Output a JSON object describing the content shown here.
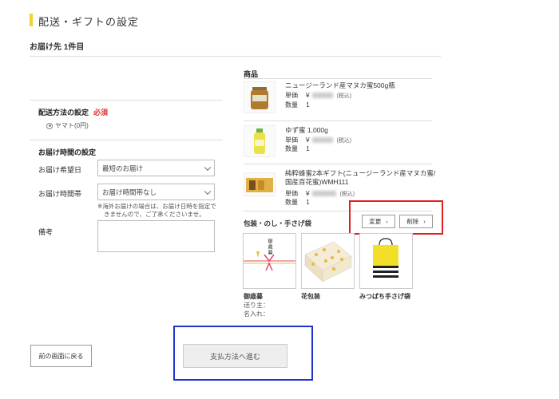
{
  "page": {
    "title": "配送・ギフトの設定"
  },
  "recipient": {
    "title": "お届け先 1件目"
  },
  "shipping_method": {
    "title": "配送方法の設定",
    "required": "必須",
    "option": "ヤマト(0円)"
  },
  "delivery_time": {
    "title": "お届け時間の設定",
    "date_label": "お届け希望日",
    "date_value": "最短のお届け",
    "time_label": "お届け時間帯",
    "time_value": "お届け時間帯なし",
    "note_line1": "※海外お届けの場合は、お届け日時を指定で",
    "note_line2": "きませんので、ご了承くださいませ。",
    "remarks_label": "備考"
  },
  "products": {
    "header": "商品",
    "price_label": "単価",
    "yen": "￥",
    "tax": "(税込)",
    "qty_label": "数量",
    "items": [
      {
        "name": "ニュージーランド産マヌカ蜜500g瓶",
        "qty": "1"
      },
      {
        "name": "ゆず蜜 1,000g",
        "qty": "1"
      },
      {
        "name_line1": "純粋蜂蜜2本ギフト(ニュージーランド産マヌカ蜜/",
        "name_line2": "国産百花蜜)WMH111",
        "qty": "1"
      }
    ]
  },
  "wrapping": {
    "title": "包装・のし・手さげ袋",
    "change_label": "変更",
    "delete_label": "削除",
    "chevron": "›",
    "options": [
      {
        "label": "御歳暮",
        "noshi_text": "御歳暮"
      },
      {
        "label": "花包装"
      },
      {
        "label": "みつばち手さげ袋"
      }
    ],
    "sender_label": "送り主：",
    "name_label": "名入れ："
  },
  "footer": {
    "back_label": "前の画面に戻る",
    "next_label": "支払方法へ進む"
  },
  "colors": {
    "accent_bar": "#f2d230",
    "required": "#d9322e",
    "highlight_red": "#e02020",
    "highlight_blue": "#2234c8"
  }
}
